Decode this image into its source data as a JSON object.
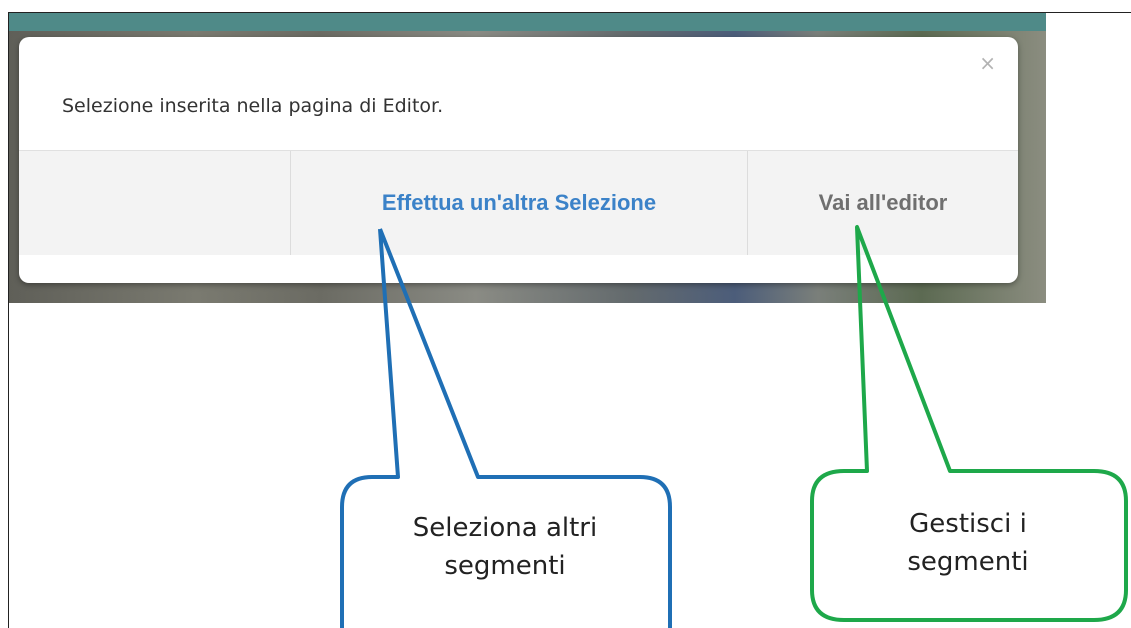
{
  "dialog": {
    "message": "Selezione inserita nella pagina di Editor.",
    "close_icon": "×",
    "buttons": {
      "other_selection": "Effettua un'altra Selezione",
      "go_to_editor": "Vai all'editor"
    }
  },
  "callouts": {
    "blue": {
      "line1": "Seleziona altri",
      "line2": "segmenti",
      "color": "#1f6fb5"
    },
    "green": {
      "line1": "Gestisci i",
      "line2": "segmenti",
      "color": "#1ea84a"
    }
  },
  "colors": {
    "link_blue": "#3b82c8",
    "header_teal": "#4f8a88"
  }
}
